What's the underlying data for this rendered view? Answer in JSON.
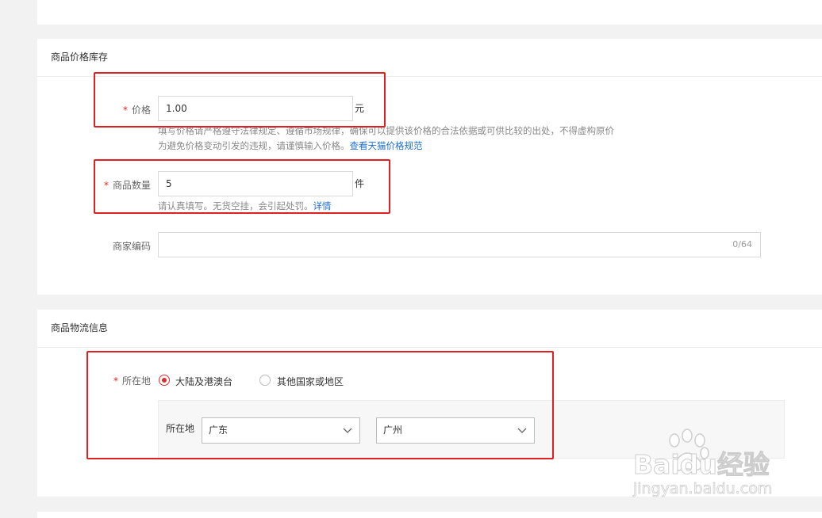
{
  "price_section": {
    "title": "商品价格库存",
    "price": {
      "label": "价格",
      "value": "1.00",
      "unit": "元",
      "help_line1": "填写价格请严格遵守法律规定、遵循市场规律，确保可以提供该价格的合法依据或可供比较的出处，不得虚构原价",
      "help_line2": "为避免价格变动引发的违规，请谨慎输入价格。",
      "help_link": "查看天猫价格规范"
    },
    "quantity": {
      "label": "商品数量",
      "value": "5",
      "unit": "件",
      "help": "请认真填写。无货空挂，会引起处罚。",
      "help_link": "详情"
    },
    "merchant_code": {
      "label": "商家编码",
      "value": "",
      "counter": "0/64"
    }
  },
  "logistics_section": {
    "title": "商品物流信息",
    "location": {
      "label": "所在地",
      "options": [
        {
          "label": "大陆及港澳台",
          "selected": true
        },
        {
          "label": "其他国家或地区",
          "selected": false
        }
      ],
      "sub_label": "所在地",
      "province": "广东",
      "city": "广州"
    }
  },
  "watermark": {
    "brand": "Baidu经验",
    "url": "jingyan.baidu.com"
  },
  "colors": {
    "required": "#e02020",
    "highlight": "#e02020",
    "link": "#1c6ed4",
    "radio_selected": "#d9302e"
  }
}
